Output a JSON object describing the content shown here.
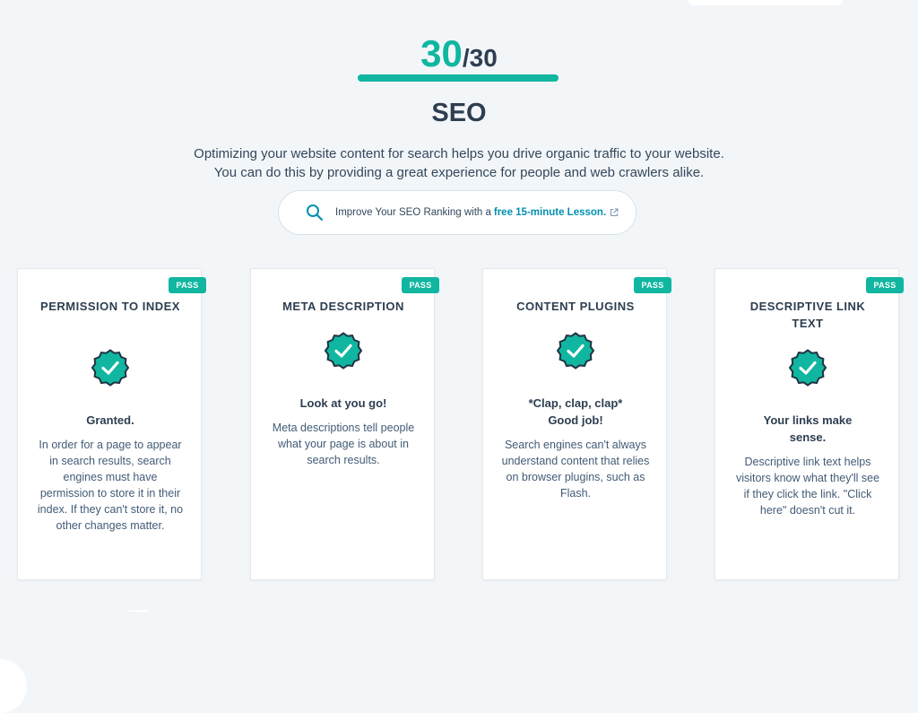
{
  "score": {
    "value": "30",
    "total": "/30"
  },
  "section": {
    "title": "SEO",
    "description_line1": "Optimizing your website content for search helps you drive organic traffic to your website.",
    "description_line2": "You can do this by providing a great experience for people and web crawlers alike."
  },
  "lesson": {
    "prefix": "Improve Your SEO Ranking with a",
    "link_text": "free 15-minute Lesson."
  },
  "colors": {
    "accent": "#10b6a0",
    "link": "#0091ae",
    "text": "#2d3e50",
    "background": "#f3f6f9"
  },
  "icons": {
    "search": "search-icon",
    "external": "external-link-icon",
    "check": "check-badge-icon"
  },
  "cards": [
    {
      "badge": "PASS",
      "title": "PERMISSION TO INDEX",
      "status": "Granted.",
      "text": "In order for a page to appear in search results, search engines must have permission to store it in their index. If they can't store it, no other changes matter."
    },
    {
      "badge": "PASS",
      "title": "META DESCRIPTION",
      "status": "Look at you go!",
      "text": "Meta descriptions tell people what your page is about in search results."
    },
    {
      "badge": "PASS",
      "title": "CONTENT PLUGINS",
      "status": "*Clap, clap, clap* Good job!",
      "text": "Search engines can't always understand content that relies on browser plugins, such as Flash."
    },
    {
      "badge": "PASS",
      "title": "DESCRIPTIVE LINK TEXT",
      "status": "Your links make sense.",
      "text": "Descriptive link text helps visitors know what they'll see if they click the link. \"Click here\" doesn't cut it."
    }
  ]
}
